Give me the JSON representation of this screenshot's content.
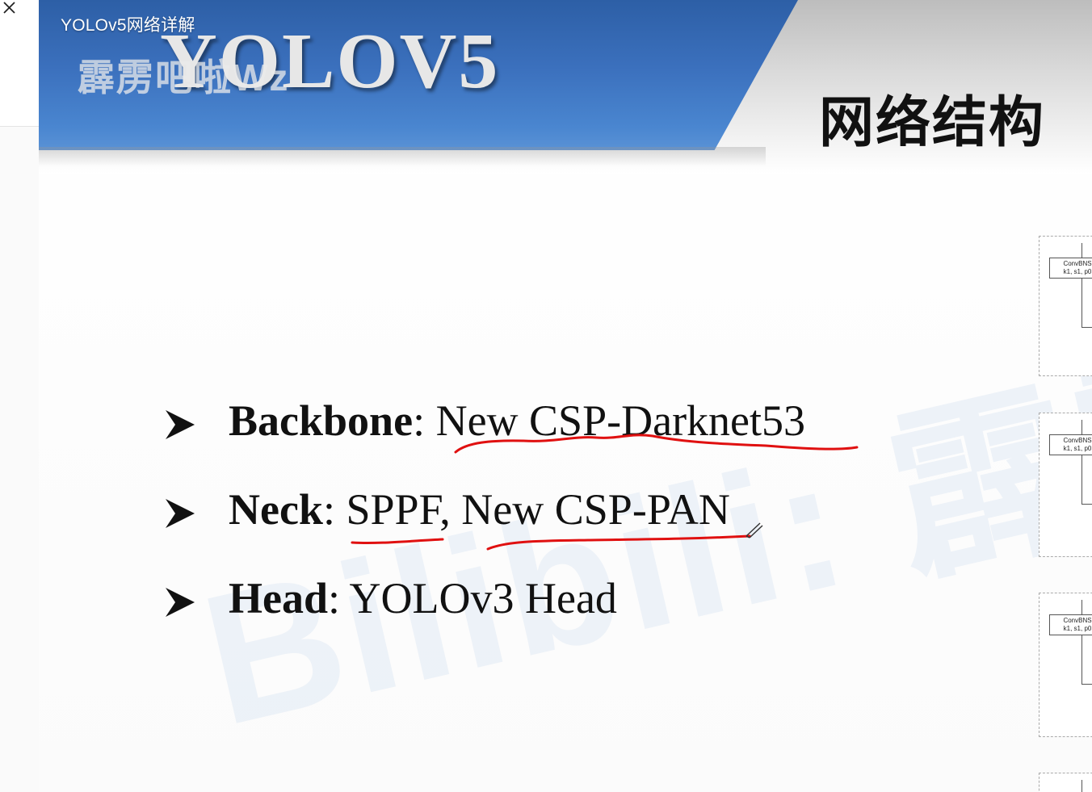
{
  "window": {
    "close_label": "×"
  },
  "header": {
    "video_title": "YOLOv5网络详解",
    "logo_text": "YOLOV5",
    "logo_watermark": "霹雳吧啦Wz",
    "heading": "网络结构"
  },
  "bullets": [
    {
      "term": "Backbone",
      "sep": ": ",
      "detail": "New CSP-Darknet53"
    },
    {
      "term": "Neck",
      "sep": ": ",
      "detail": "SPPF, New CSP-PAN"
    },
    {
      "term": "Head",
      "sep": ": ",
      "detail": "YOLOv3 Head"
    }
  ],
  "diagram_blocks": [
    {
      "line1": "ConvBNS",
      "line2": "k1, s1, p0"
    },
    {
      "line1": "ConvBNS",
      "line2": "k1, s1, p0"
    },
    {
      "line1": "ConvBNS",
      "line2": "k1, s1, p0"
    }
  ],
  "watermark": "Bilibili: 霹雳",
  "colors": {
    "banner_blue": "#3b70bd",
    "annotation_red": "#e01010",
    "text": "#111111"
  }
}
